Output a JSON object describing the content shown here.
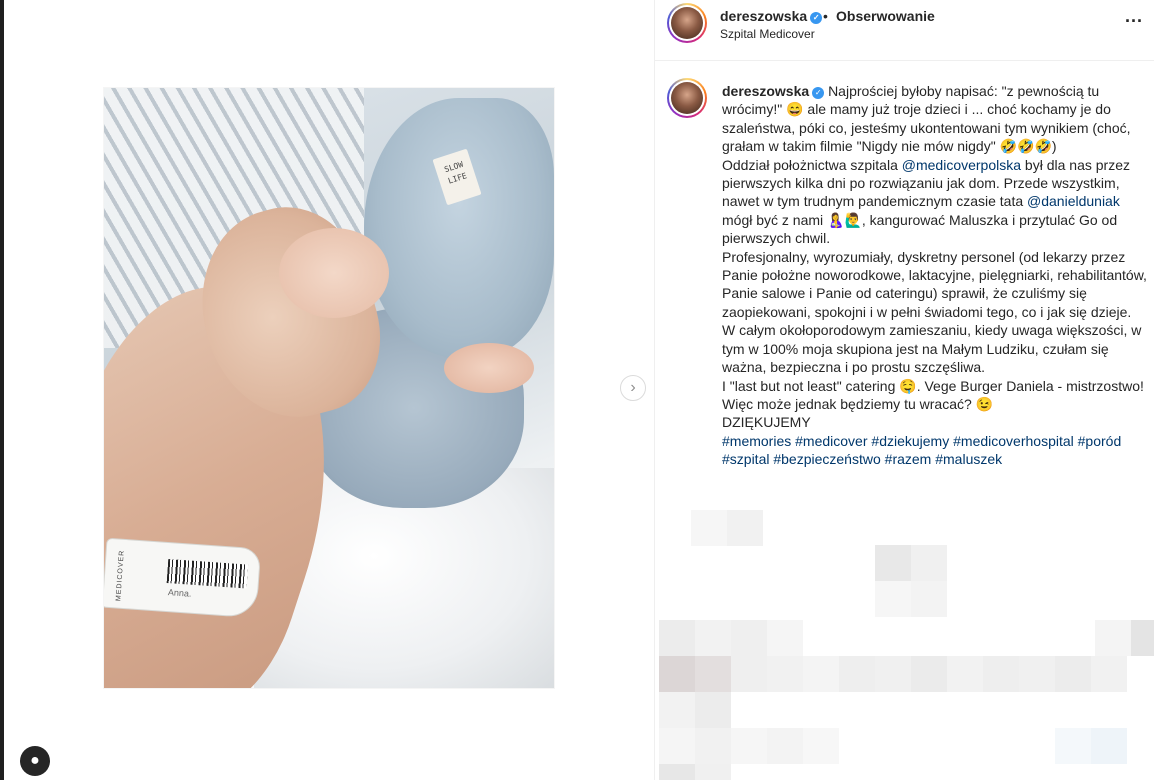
{
  "post": {
    "username": "dereszowska",
    "dot": "•",
    "follow_label": "Obserwowanie",
    "location": "Szpital Medicover",
    "more_label": "..."
  },
  "media": {
    "hat_label": "SLOW LIFE",
    "wristband_logo": "MEDICOVER",
    "wristband_name": "Anna.",
    "next_icon": "chevron-right-icon"
  },
  "caption": {
    "username": "dereszowska",
    "p1": "Najprościej byłoby napisać: \"z pewnością tu wrócimy!\" 😄 ale mamy już troje dzieci i ... choć kochamy je do szaleństwa, póki co, jesteśmy ukontentowani tym wynikiem (choć, grałam w takim filmie \"Nigdy nie mów nigdy\" 🤣🤣🤣)",
    "p2_a": "Oddział położnictwa szpitala ",
    "p2_mention": "@medicoverpolska",
    "p2_b": " był dla nas przez pierwszych kilka dni po rozwiązaniu jak dom. Przede wszystkim, nawet w tym trudnym pandemicznym czasie tata ",
    "p2_mention2": "@danielduniak",
    "p2_c": " mógł być z nami 🤱🙋‍♂️, kangurować Maluszka i przytulać Go od pierwszych chwil.",
    "p3": "Profesjonalny, wyrozumiały, dyskretny personel (od lekarzy przez Panie położne noworodkowe, laktacyjne, pielęgniarki, rehabilitantów, Panie salowe i Panie od cateringu) sprawił, że czuliśmy się zaopiekowani, spokojni i w pełni świadomi tego, co i jak się dzieje.",
    "p4": "W całym okołoporodowym zamieszaniu, kiedy uwaga większości, w tym w 100% moja skupiona jest na Małym Ludziku, czułam się ważna, bezpieczna i po prostu szczęśliwa.",
    "p5": "I \"last but not least\" catering 🤤. Vege Burger Daniela - mistrzostwo!",
    "p6": "Więc może jednak będziemy tu wracać? 😉",
    "p7": "DZIĘKUJEMY",
    "hashtags": [
      "#memories",
      "#medicover",
      "#dziekujemy",
      "#medicoverhospital",
      "#poród",
      "#szpital",
      "#bezpieczeństwo",
      "#razem",
      "#maluszek"
    ]
  },
  "colors": {
    "text": "#262626",
    "link": "#00376b",
    "verified": "#3897f0",
    "border": "#efefef"
  }
}
